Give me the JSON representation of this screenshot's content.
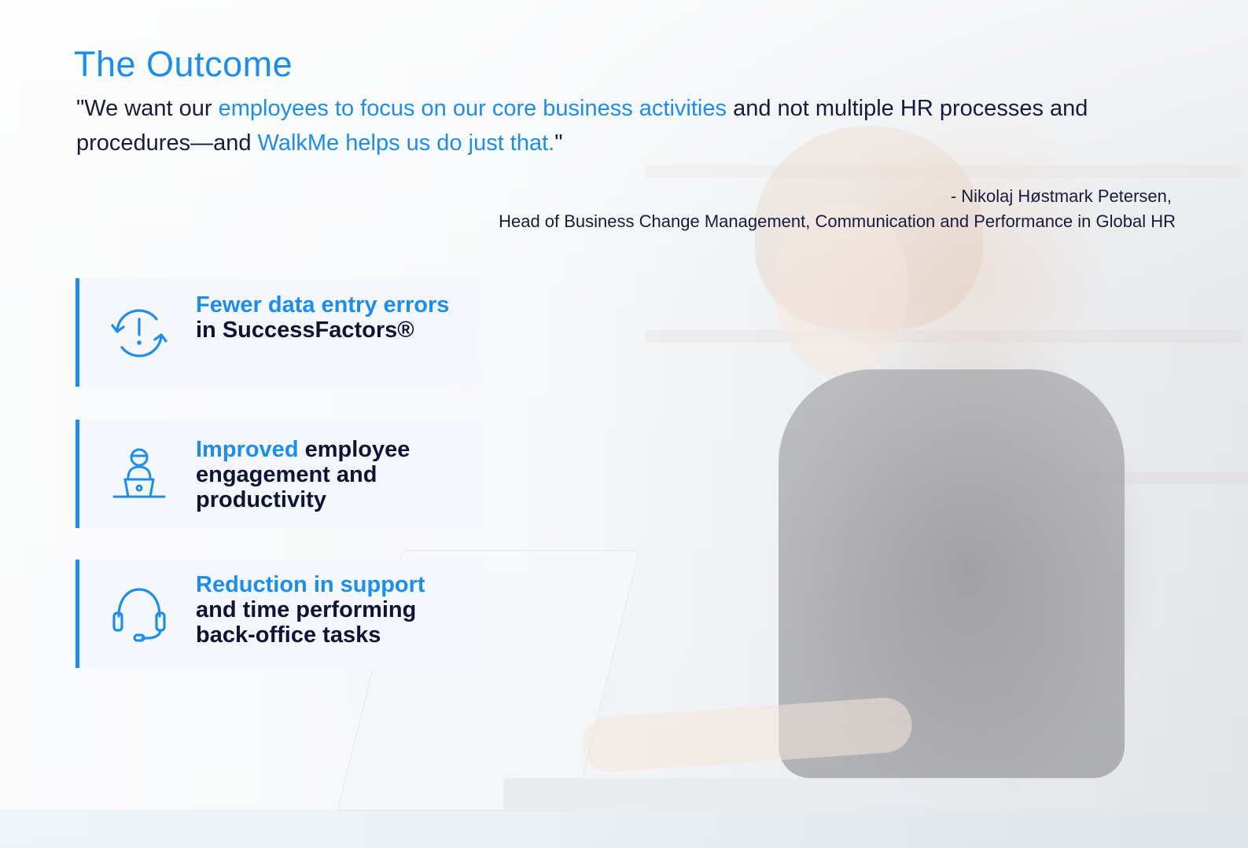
{
  "heading": "The Outcome",
  "quote": {
    "p1": "\"We want our ",
    "h1": "employees to focus on our core business activities",
    "p2": " and not multiple HR processes and procedures—and ",
    "h2": "WalkMe helps us do just that.",
    "p3": "\""
  },
  "attribution": {
    "name_line": "- Nikolaj Høstmark Petersen,",
    "role_line": "Head of Business Change Management, Communication and Performance in Global HR"
  },
  "outcomes": [
    {
      "icon": "refresh-alert-icon",
      "accent": "Fewer data entry errors",
      "rest": " in SuccessFactors®"
    },
    {
      "icon": "person-laptop-icon",
      "accent": "Improved",
      "rest": " employee engagement and productivity"
    },
    {
      "icon": "headset-icon",
      "accent": "Reduction in support",
      "rest": " and time performing back-office tasks"
    }
  ],
  "colors": {
    "accent": "#1a8ef0",
    "text_dark": "#0f1437"
  }
}
